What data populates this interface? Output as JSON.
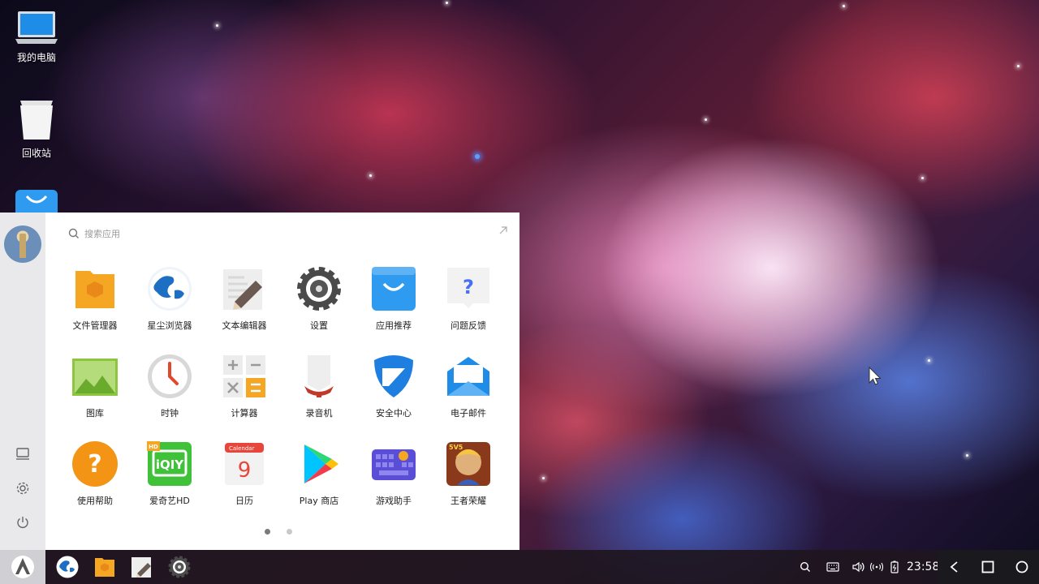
{
  "desktop": {
    "icons": [
      {
        "label": "我的电脑",
        "icon": "laptop-icon"
      },
      {
        "label": "回收站",
        "icon": "trash-bin-icon"
      },
      {
        "label": "",
        "icon": "app-store-icon"
      }
    ]
  },
  "start_menu": {
    "search": {
      "placeholder": "搜索应用"
    },
    "apps": [
      {
        "label": "文件管理器",
        "icon": "file-manager-icon"
      },
      {
        "label": "星尘浏览器",
        "icon": "browser-globe-icon"
      },
      {
        "label": "文本编辑器",
        "icon": "text-editor-icon"
      },
      {
        "label": "设置",
        "icon": "settings-gear-icon"
      },
      {
        "label": "应用推荐",
        "icon": "app-store-bag-icon"
      },
      {
        "label": "问题反馈",
        "icon": "feedback-question-icon"
      },
      {
        "label": "图库",
        "icon": "gallery-icon"
      },
      {
        "label": "时钟",
        "icon": "clock-icon"
      },
      {
        "label": "计算器",
        "icon": "calculator-icon"
      },
      {
        "label": "录音机",
        "icon": "recorder-icon"
      },
      {
        "label": "安全中心",
        "icon": "security-shield-icon"
      },
      {
        "label": "电子邮件",
        "icon": "email-envelope-icon"
      },
      {
        "label": "使用帮助",
        "icon": "help-question-icon"
      },
      {
        "label": "爱奇艺HD",
        "icon": "iqiyi-icon"
      },
      {
        "label": "日历",
        "icon": "calendar-icon"
      },
      {
        "label": "Play 商店",
        "icon": "play-store-icon"
      },
      {
        "label": "游戏助手",
        "icon": "game-keyboard-icon"
      },
      {
        "label": "王者荣耀",
        "icon": "game-hero-icon"
      }
    ],
    "iqiyi_badge": "HD",
    "calendar_header": "Calendar",
    "calendar_day": "9",
    "game_badge": "5V5",
    "page_count": 2,
    "active_page": 1
  },
  "taskbar": {
    "clock": "23:58",
    "pinned": [
      "browser-globe-icon",
      "file-manager-icon",
      "text-editor-icon",
      "settings-gear-icon"
    ]
  },
  "colors": {
    "accent_orange": "#f5a623",
    "accent_blue": "#2f9bf0",
    "taskbar_bg": "#1e1620"
  }
}
